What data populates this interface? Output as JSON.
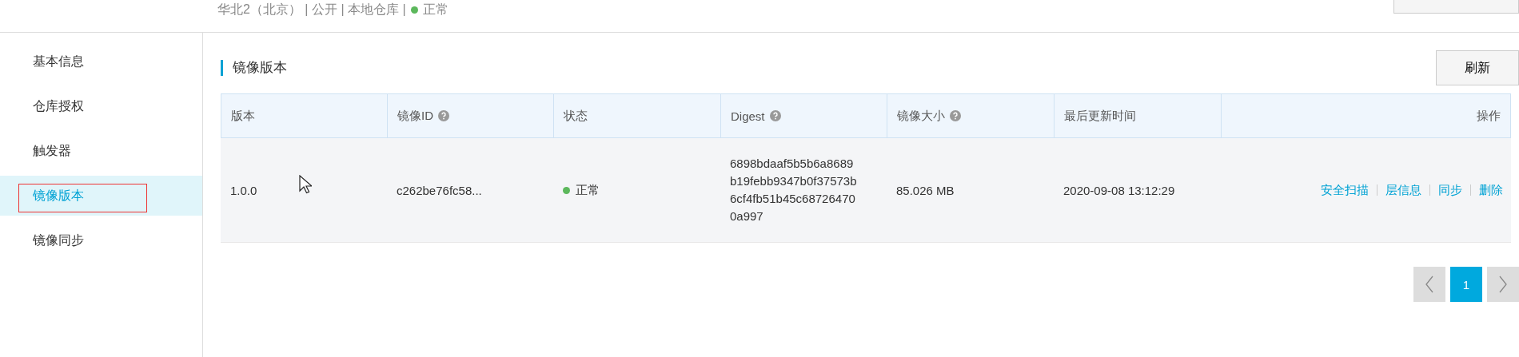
{
  "header": {
    "breadcrumb": "华北2（北京） | 公开 | 本地仓库 |",
    "status": {
      "label": "正常",
      "color": "#5cb85c"
    }
  },
  "sidebar": {
    "items": [
      {
        "label": "基本信息",
        "selected": false,
        "annotated": false
      },
      {
        "label": "仓库授权",
        "selected": false,
        "annotated": false
      },
      {
        "label": "触发器",
        "selected": false,
        "annotated": false
      },
      {
        "label": "镜像版本",
        "selected": true,
        "annotated": true
      },
      {
        "label": "镜像同步",
        "selected": false,
        "annotated": false
      }
    ]
  },
  "section": {
    "title": "镜像版本",
    "refresh_button": "刷新"
  },
  "table": {
    "columns": [
      {
        "label": "版本"
      },
      {
        "label": "镜像ID",
        "help": true
      },
      {
        "label": "状态"
      },
      {
        "label": "Digest",
        "help": true
      },
      {
        "label": "镜像大小",
        "help": true
      },
      {
        "label": "最后更新时间"
      },
      {
        "label": "操作"
      }
    ],
    "rows": [
      {
        "version": "1.0.0",
        "image_id": "c262be76fc58...",
        "status": {
          "label": "正常",
          "color": "#5cb85c"
        },
        "digest": "6898bdaaf5b5b6a8689b19febb9347b0f37573b6cf4fb51b45c687264700a997",
        "size": "85.026 MB",
        "updated": "2020-09-08 13:12:29",
        "actions": [
          "安全扫描",
          "层信息",
          "同步",
          "删除"
        ]
      }
    ]
  },
  "pagination": {
    "pages": [
      {
        "label": "1",
        "selected": true
      }
    ]
  }
}
